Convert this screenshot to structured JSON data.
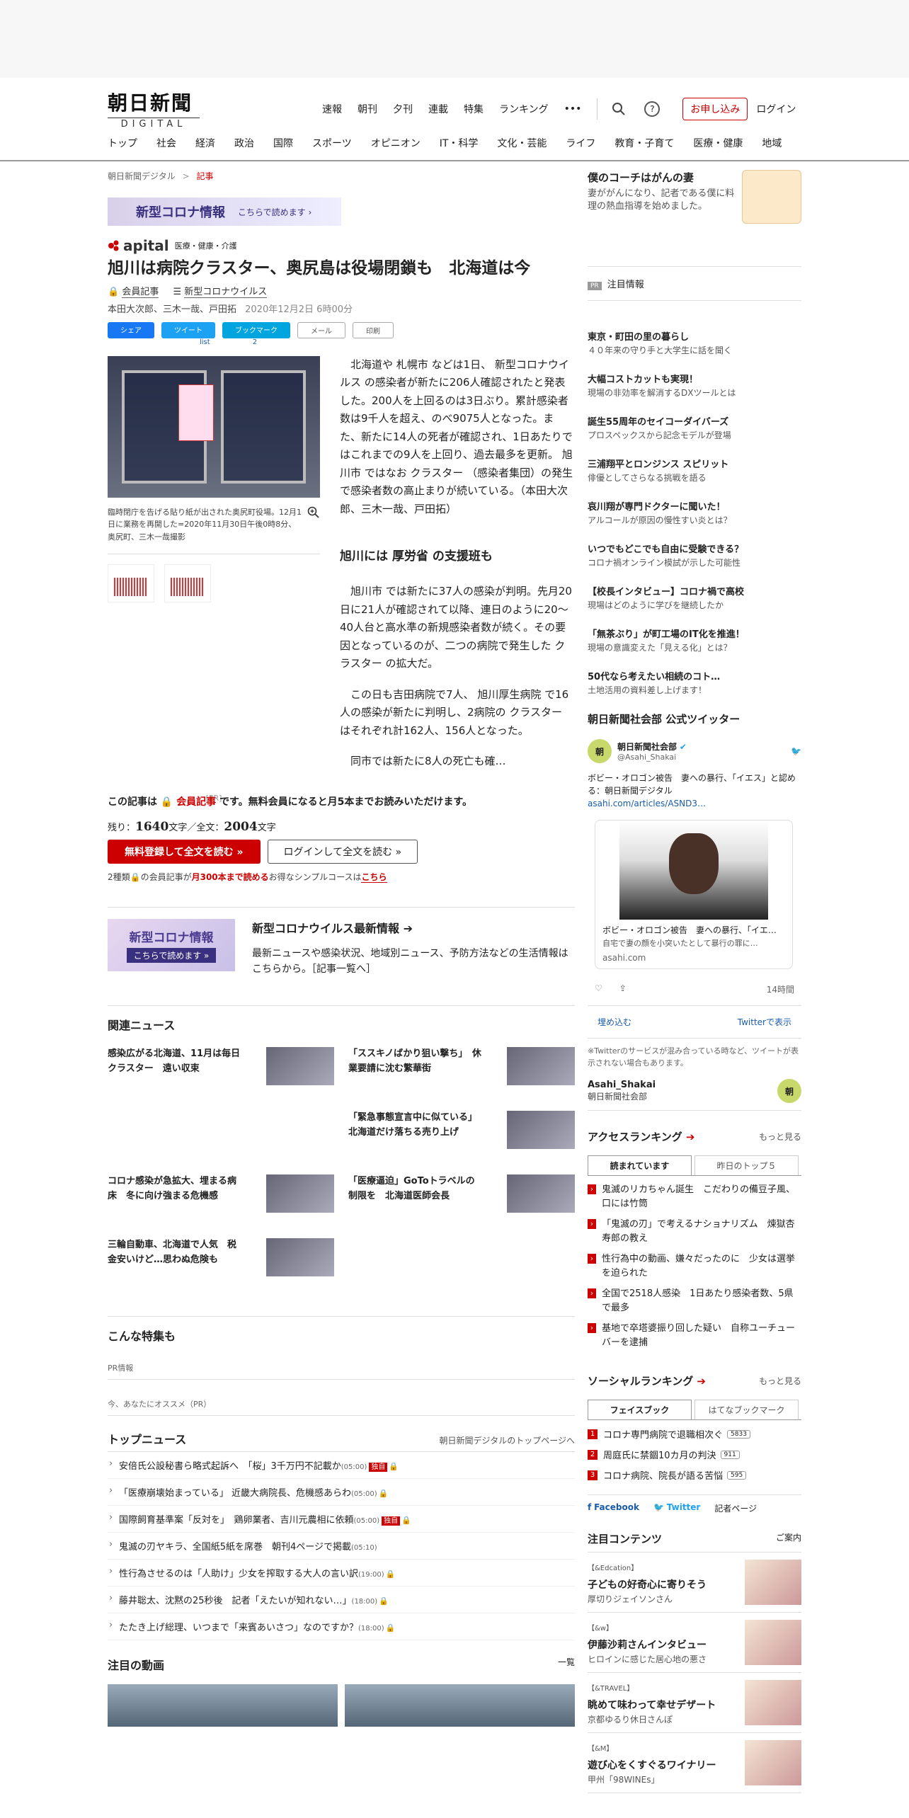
{
  "header": {
    "logo_main": "朝日新聞",
    "logo_sub": "DIGITAL",
    "util_links": [
      "速報",
      "朝刊",
      "夕刊",
      "連載",
      "特集",
      "ランキング"
    ],
    "more": "•••",
    "help": "?",
    "apply": "お申し込み",
    "login": "ログイン"
  },
  "nav": [
    "トップ",
    "社会",
    "経済",
    "政治",
    "国際",
    "スポーツ",
    "オピニオン",
    "IT・科学",
    "文化・芸能",
    "ライフ",
    "教育・子育て",
    "医療・健康",
    "地域"
  ],
  "breadcrumb": {
    "home": "朝日新聞デジタル",
    "sep": ">",
    "current": "記事"
  },
  "covid_banner": {
    "title": "新型コロナ情報",
    "link": "こちらで読めます ›"
  },
  "apital": {
    "name": "apital",
    "tag": "医療・健康・介護"
  },
  "article": {
    "headline": "旭川は病院クラスター、奥尻島は役場閉鎖も　北海道は今",
    "member": "会員記事",
    "topic": "新型コロナウイルス",
    "authors": "本田大次郎、三木一哉、戸田拓",
    "date": "2020年12月2日 6時00分",
    "share": [
      "シェア",
      "ツイート",
      "ブックマーク",
      "メール",
      "印刷"
    ],
    "tweet_count": "list",
    "bookmark_count": "2",
    "caption": "臨時閉庁を告げる貼り紙が出された奥尻町役場。12月1日に業務を再開した=2020年11月30日午後0時8分、奥尻町、三木一哉撮影",
    "pr": "[PR]",
    "p1": "北海道や 札幌市 などは1日、 新型コロナウイルス の感染者が新たに206人確認されたと発表した。200人を上回るのは3日ぶり。累計感染者数は9千人を超え、のべ9075人となった。また、新たに14人の死者が確認され、1日あたりではこれまでの9人を上回り、過去最多を更新。 旭川市 ではなお クラスター （感染者集団）の発生で感染者数の高止まりが続いている。（本田大次郎、三木一哉、戸田拓）",
    "h2": "旭川には 厚労省 の支援班も",
    "p2": "旭川市 では新たに37人の感染が判明。先月20日に21人が確認されて以降、連日のように20～40人台と高水準の新規感染者数が続く。その要因となっているのが、二つの病院で発生した クラスター の拡大だ。",
    "p3": "この日も吉田病院で7人、 旭川厚生病院 で16人の感染が新たに判明し、2病院の クラスター はそれぞれ計162人、156人となった。",
    "p4": "同市では新たに8人の死亡も確…",
    "notice_a": "この記事は",
    "notice_member": "会員記事",
    "notice_b": "です。無料会員になると月5本までお読みいただけます。",
    "remain_label": "残り：",
    "remain": "1640",
    "total_label": "文字／全文：",
    "total": "2004",
    "char": "文字",
    "btn_register": "無料登録して全文を読む »",
    "btn_login": "ログインして全文を読む »",
    "course_a": "2種類",
    "course_b": "の会員記事が",
    "course_c": "月300本まで読める",
    "course_d": "お得なシンプルコースは",
    "course_link": "こちら"
  },
  "covid_box": {
    "bn_title": "新型コロナ情報",
    "bn_link": "こちらで読めます »",
    "title": "新型コロナウイルス最新情報 ➔",
    "desc": "最新ニュースや感染状況、地域別ニュース、予防方法などの生活情報はこちらから。［記事一覧へ］"
  },
  "related": {
    "title": "関連ニュース",
    "items": [
      "感染広がる北海道、11月は毎日クラスター　遠い収束",
      "「ススキノばかり狙い撃ち」　休業要請に沈む繁華街",
      "",
      "「緊急事態宣言中に似ている」北海道だけ落ちる売り上げ",
      "コロナ感染が急拡大、埋まる病床　冬に向け強まる危機感",
      "「医療逼迫」GoToトラベルの制限を　北海道医師会長",
      "三輪自動車、北海道で人気　税金安いけど…思わぬ危険も",
      ""
    ]
  },
  "special": {
    "title": "こんな特集も",
    "pr1": "PR情報",
    "pr2": "今、あなたにオススメ（PR）"
  },
  "top_news": {
    "title": "トップニュース",
    "link": "朝日新聞デジタルのトップページへ",
    "items": [
      {
        "t": "安倍氏公設秘書ら略式起訴へ　「桜」3千万円不記載か",
        "tm": "(05:00)",
        "badge": "独自"
      },
      {
        "t": "「医療崩壊始まっている」 近畿大病院長、危機感あらわ",
        "tm": "(05:00)",
        "badge": ""
      },
      {
        "t": "国際飼育基準案「反対を」　鶏卵業者、吉川元農相に依頼",
        "tm": "(05:00)",
        "badge": "独自"
      },
      {
        "t": "鬼滅の刃ヤキラ、全国紙5紙を席巻　朝刊4ページで掲載",
        "tm": "(05:10)",
        "badge": ""
      },
      {
        "t": "性行為させるのは「人助け」少女を搾取する大人の言い訳",
        "tm": "(19:00)",
        "badge": ""
      },
      {
        "t": "藤井聡太、沈黙の25秒後　記者「えたいが知れない…」",
        "tm": "(18:00)",
        "badge": ""
      },
      {
        "t": "たたき上げ総理、いつまで「来賓あいさつ」なのですか？",
        "tm": "(18:00)",
        "badge": ""
      }
    ]
  },
  "video": {
    "title": "注目の動画",
    "link": "一覧"
  },
  "side": {
    "coach_title": "僕のコーチはがんの妻",
    "coach_desc": "妻ががんになり、記者である僕に料理の熱血指導を始めました。",
    "note": "注目情報",
    "pr_tag": "PR",
    "pr_items": [
      {
        "t": "東京・町田の里の暮らし",
        "s": "４０年来の守り手と大学生に話を聞く"
      },
      {
        "t": "大幅コストカットも実現！",
        "s": "現場の非効率を解消するDXツールとは"
      },
      {
        "t": "誕生55周年のセイコーダイバーズ",
        "s": "プロスペックスから記念モデルが登場"
      },
      {
        "t": "三浦翔平とロンジンス スピリット",
        "s": "俳優としてさらなる挑戦を語る"
      },
      {
        "t": "哀川翔が専門ドクターに聞いた！",
        "s": "アルコールが原因の慢性すい炎とは？"
      },
      {
        "t": "いつでもどこでも自由に受験できる？",
        "s": "コロナ禍オンライン模試が示した可能性"
      },
      {
        "t": "【校長インタビュー】コロナ禍で高校",
        "s": "現場はどのように学びを継続したか"
      },
      {
        "t": "「無茶ぶり」が町工場のIT化を推進！",
        "s": "現場の意識変えた「見える化」とは？"
      },
      {
        "t": "50代なら考えたい相続のコト…",
        "s": "土地活用の資料差し上げます！"
      }
    ],
    "twitter_title": "朝日新聞社会部 公式ツイッター",
    "tw_name": "朝日新聞社会部",
    "tw_handle": "@Asahi_Shakai",
    "tw_avatar": "朝",
    "tw_text": "ボビー・オロゴン被告　妻への暴行、「イエス」と認める：朝日新聞デジタル",
    "tw_link": "asahi.com/articles/ASND3…",
    "tw_card_title": "ボビー・オロゴン被告　妻への暴行、「イエ…",
    "tw_card_sub": "自宅で妻の顔を小突いたとして暴行の罪に…",
    "tw_card_domain": "asahi.com",
    "tw_time": "14時間",
    "tw_embed": "埋め込む",
    "tw_view": "Twitterで表示",
    "tw_note": "※Twitterのサービスが混み合っている時など、ツイートが表示されない場合もあります。",
    "tw_foot_handle": "Asahi_Shakai",
    "tw_foot_name": "朝日新聞社会部",
    "access_title": "アクセスランキング",
    "more": "もっと見る",
    "access_tabs": [
      "読まれています",
      "昨日のトップ５"
    ],
    "access_items": [
      "鬼滅のリカちゃん誕生　こだわりの備豆子風、口には竹筒",
      "「鬼滅の刃」で考えるナショナリズム　煉獄杏寿郎の教え",
      "性行為中の動画、嫌々だったのに　少女は選挙を迫られた",
      "全国で2518人感染　1日あたり感染者数、5県で最多",
      "基地で卒塔婆振り回した疑い　自称ユーチューバーを逮捕"
    ],
    "social_title": "ソーシャルランキング",
    "social_tabs": [
      "フェイスブック",
      "はてなブックマーク"
    ],
    "social_items": [
      {
        "n": "1",
        "t": "コロナ専門病院で退職相次ぐ",
        "c": "5833"
      },
      {
        "n": "2",
        "t": "周庭氏に禁錮10カ月の判決",
        "c": "911"
      },
      {
        "n": "3",
        "t": "コロナ病院、院長が語る苦悩",
        "c": "595"
      }
    ],
    "social_links": [
      "Facebook",
      "Twitter",
      "記者ページ"
    ],
    "attn_title": "注目コンテンツ",
    "attn_link": "ご案内",
    "attn_items": [
      {
        "tag": "【&Edcation】",
        "t": "子どもの好奇心に寄りそう",
        "s": "厚切りジェイソンさん"
      },
      {
        "tag": "【&w】",
        "t": "伊藤沙莉さんインタビュー",
        "s": "ヒロインに感じた居心地の悪さ"
      },
      {
        "tag": "【&TRAVEL】",
        "t": "眺めて味わって幸せデザート",
        "s": "京都ゆるり休日さんぽ"
      },
      {
        "tag": "【&M】",
        "t": "遊び心をくすぐるワイナリー",
        "s": "甲州「98WINEs」"
      }
    ]
  }
}
